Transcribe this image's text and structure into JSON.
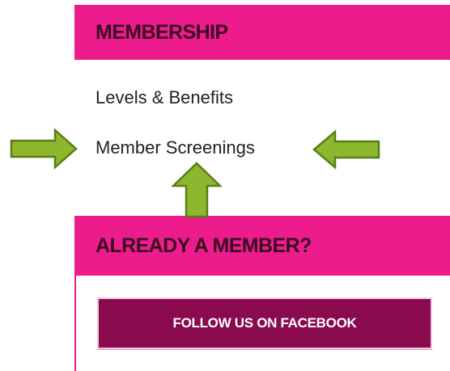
{
  "sidebar": {
    "membership_title": "MEMBERSHIP",
    "links": [
      {
        "label": "Levels & Benefits"
      },
      {
        "label": "Member Screenings"
      }
    ],
    "already_member_title": "ALREADY A MEMBER?",
    "facebook_button_label": "FOLLOW US ON FACEBOOK"
  },
  "annotations": {
    "arrow_color": "#8db72c",
    "arrow_outline": "#5b7d17",
    "arrows": [
      "arrow-right-icon",
      "arrow-left-icon",
      "arrow-up-icon"
    ]
  },
  "colors": {
    "header_pink": "#ec1c8c",
    "button_plum": "#8a0a4e",
    "header_text": "#3a0a22"
  }
}
